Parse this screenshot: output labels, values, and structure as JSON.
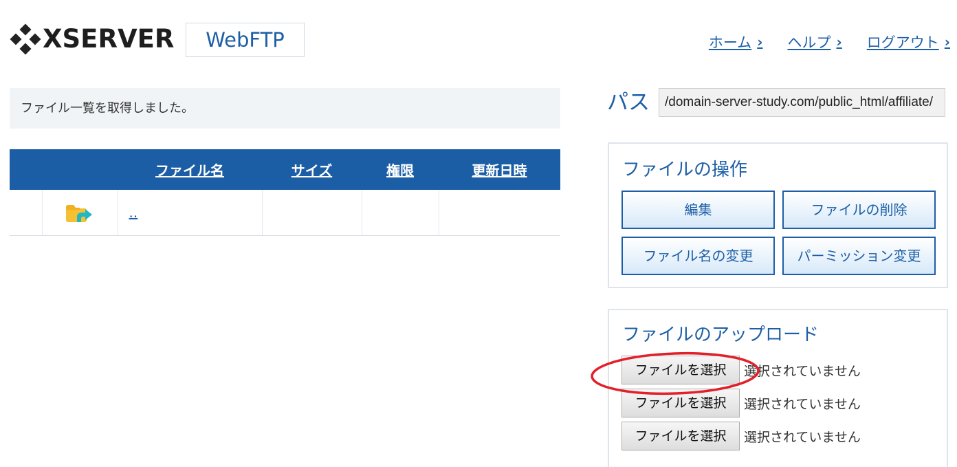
{
  "header": {
    "logo_text": "XSERVER",
    "badge": "WebFTP",
    "nav": [
      {
        "label": "ホーム",
        "icon": "chevron-right-icon"
      },
      {
        "label": "ヘルプ",
        "icon": "chevron-right-icon"
      },
      {
        "label": "ログアウト",
        "icon": "chevron-right-icon"
      }
    ]
  },
  "status_message": "ファイル一覧を取得しました。",
  "table": {
    "columns": [
      "",
      "",
      "ファイル名",
      "サイズ",
      "権限",
      "更新日時"
    ],
    "rows": [
      {
        "icon": "parent-folder-icon",
        "name": "..",
        "size": "",
        "permission": "",
        "modified": ""
      }
    ]
  },
  "path": {
    "label": "パス",
    "value": "/domain-server-study.com/public_html/affiliate/"
  },
  "file_operations": {
    "title": "ファイルの操作",
    "buttons": [
      "編集",
      "ファイルの削除",
      "ファイル名の変更",
      "パーミッション変更"
    ]
  },
  "upload": {
    "title": "ファイルのアップロード",
    "rows": [
      {
        "button": "ファイルを選択",
        "status": "選択されていません"
      },
      {
        "button": "ファイルを選択",
        "status": "選択されていません"
      },
      {
        "button": "ファイルを選択",
        "status": "選択されていません"
      }
    ]
  },
  "colors": {
    "accent": "#1d5fa6",
    "table_header": "#1c5ea6",
    "annotation_circle": "#e3202a",
    "folder_yellow": "#f5c033",
    "arrow_teal": "#1fb8c4"
  }
}
